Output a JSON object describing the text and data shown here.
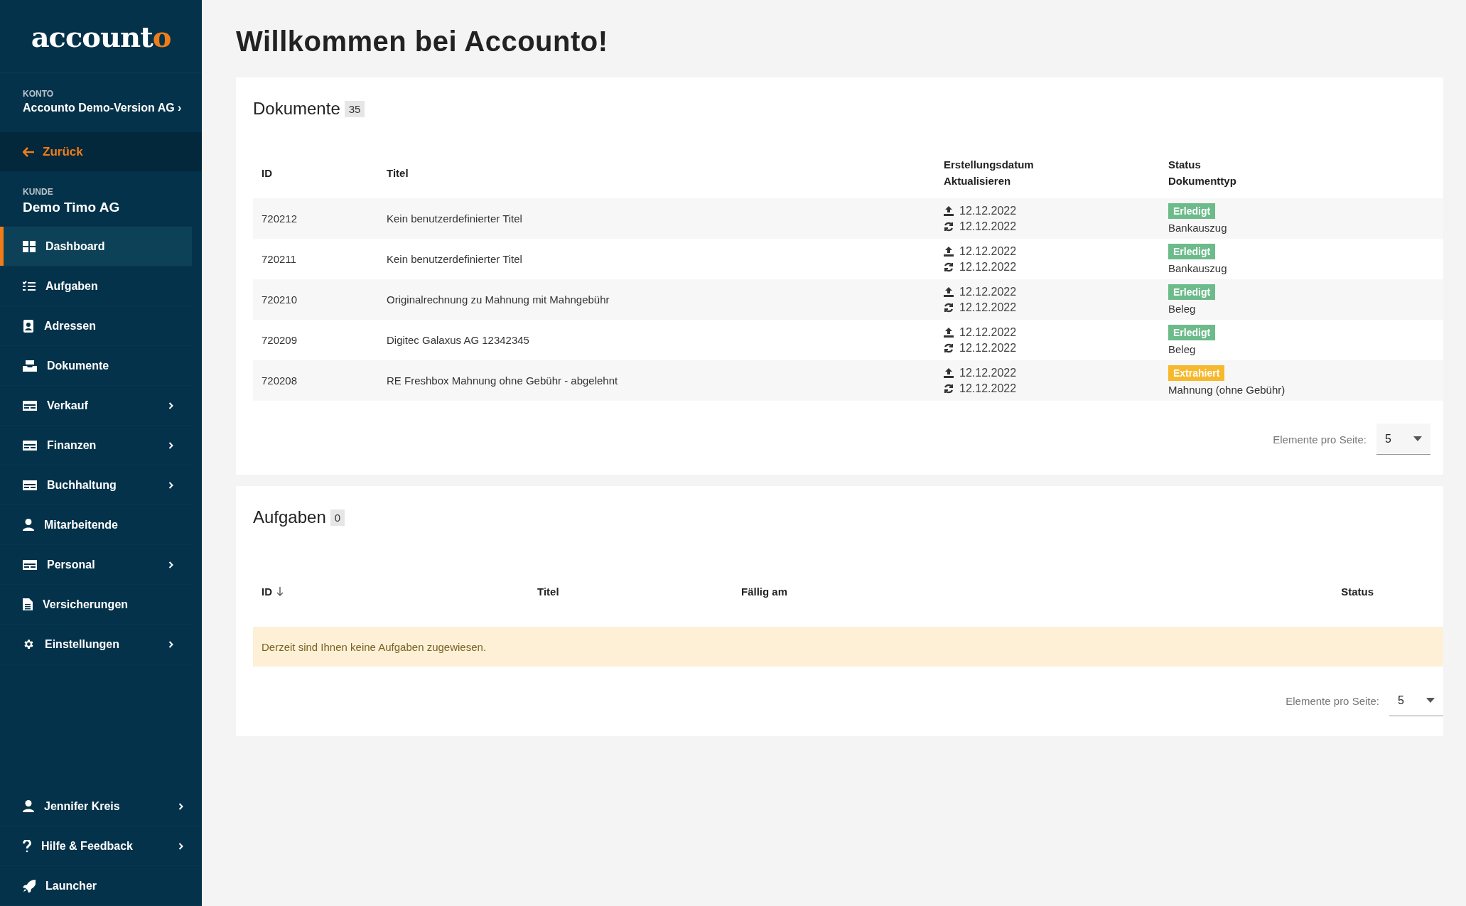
{
  "sidebar": {
    "logo": {
      "main": "account",
      "accent": "o"
    },
    "account": {
      "label": "KONTO",
      "name": "Accounto Demo-Version AG ›"
    },
    "back": {
      "label": "Zurück"
    },
    "customer": {
      "label": "KUNDE",
      "name": "Demo Timo AG"
    },
    "items": [
      {
        "label": "Dashboard",
        "selected": true,
        "expandable": false
      },
      {
        "label": "Aufgaben",
        "selected": false,
        "expandable": false
      },
      {
        "label": "Adressen",
        "selected": false,
        "expandable": false
      },
      {
        "label": "Dokumente",
        "selected": false,
        "expandable": false
      },
      {
        "label": "Verkauf",
        "selected": false,
        "expandable": true
      },
      {
        "label": "Finanzen",
        "selected": false,
        "expandable": true
      },
      {
        "label": "Buchhaltung",
        "selected": false,
        "expandable": true
      },
      {
        "label": "Mitarbeitende",
        "selected": false,
        "expandable": false
      },
      {
        "label": "Personal",
        "selected": false,
        "expandable": true
      },
      {
        "label": "Versicherungen",
        "selected": false,
        "expandable": false
      },
      {
        "label": "Einstellungen",
        "selected": false,
        "expandable": true
      }
    ],
    "bottom_items": [
      {
        "label": "Jennifer Kreis",
        "expandable": true
      },
      {
        "label": "Hilfe & Feedback",
        "expandable": true
      },
      {
        "label": "Launcher",
        "expandable": false
      }
    ]
  },
  "page_title": "Willkommen bei Accounto!",
  "documents": {
    "title": "Dokumente",
    "count": "35",
    "columns": [
      [
        "ID"
      ],
      [
        "Titel"
      ],
      [
        "Erstellungsdatum",
        "Aktualisieren"
      ],
      [
        "Status",
        "Dokumenttyp"
      ]
    ],
    "rows": [
      {
        "id": "720212",
        "title": "Kein benutzerdefinierter Titel",
        "created": "12.12.2022",
        "updated": "12.12.2022",
        "status": "Erledigt",
        "color": "#6cbb8a",
        "type": "Bankauszug"
      },
      {
        "id": "720211",
        "title": "Kein benutzerdefinierter Titel",
        "created": "12.12.2022",
        "updated": "12.12.2022",
        "status": "Erledigt",
        "color": "#6cbb8a",
        "type": "Bankauszug"
      },
      {
        "id": "720210",
        "title": "Originalrechnung zu Mahnung mit Mahngebühr",
        "created": "12.12.2022",
        "updated": "12.12.2022",
        "status": "Erledigt",
        "color": "#6cbb8a",
        "type": "Beleg"
      },
      {
        "id": "720209",
        "title": "Digitec Galaxus AG 12342345",
        "created": "12.12.2022",
        "updated": "12.12.2022",
        "status": "Erledigt",
        "color": "#6cbb8a",
        "type": "Beleg"
      },
      {
        "id": "720208",
        "title": "RE Freshbox Mahnung ohne Gebühr - abgelehnt",
        "created": "12.12.2022",
        "updated": "12.12.2022",
        "status": "Extrahiert",
        "color": "#f6b82d",
        "type": "Mahnung (ohne Gebühr)"
      }
    ],
    "pager": {
      "label": "Elemente pro Seite:",
      "value": "5"
    }
  },
  "tasks": {
    "title": "Aufgaben",
    "count": "0",
    "columns": [
      {
        "label": "ID",
        "sorted": true
      },
      {
        "label": "Titel",
        "sorted": false
      },
      {
        "label": "Fällig am",
        "sorted": false
      },
      {
        "label": "Status",
        "sorted": false
      }
    ],
    "empty_message": "Derzeit sind Ihnen keine Aufgaben zugewiesen.",
    "pager": {
      "label": "Elemente pro Seite:",
      "value": "5"
    }
  }
}
